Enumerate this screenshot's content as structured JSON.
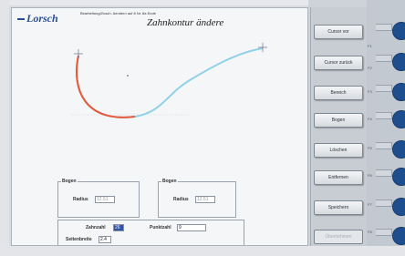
{
  "header": {
    "logo": "Lorsch",
    "subtitle": "Bearbeitung/Zusch. Aendern auf 8 Nr. 8a Ende",
    "title": "Zahnkontur ändere"
  },
  "profile": {
    "arc_color": "#e8583a",
    "curve_color": "#8fd1e6"
  },
  "left_group": {
    "label": "Bogen",
    "radius_label": "Radius",
    "radius_value": "12.51"
  },
  "right_group": {
    "label": "Bogen",
    "radius_label": "Radius",
    "radius_value": "12.51"
  },
  "bottom_group": {
    "tooth_count_label": "Zahnzahl",
    "tooth_count_value": "26",
    "point_label": "Punktzahl",
    "point_value": "9",
    "angle_label": "Seitenbreite",
    "angle_value": "2.4"
  },
  "buttons": [
    {
      "label": "Cursor vor",
      "enabled": true
    },
    {
      "label": "Cursor zurück",
      "enabled": true
    },
    {
      "label": "Bereich",
      "enabled": true
    },
    {
      "label": "Bogen",
      "enabled": true
    },
    {
      "label": "Löschen",
      "enabled": true
    },
    {
      "label": "Entfernen",
      "enabled": true
    },
    {
      "label": "Speichern",
      "enabled": true
    },
    {
      "label": "Übernehmen",
      "enabled": false
    }
  ],
  "rail_ticks": [
    "",
    "F1",
    "F2",
    "F3",
    "F4",
    "F5",
    "F6",
    "F7",
    "F8"
  ]
}
